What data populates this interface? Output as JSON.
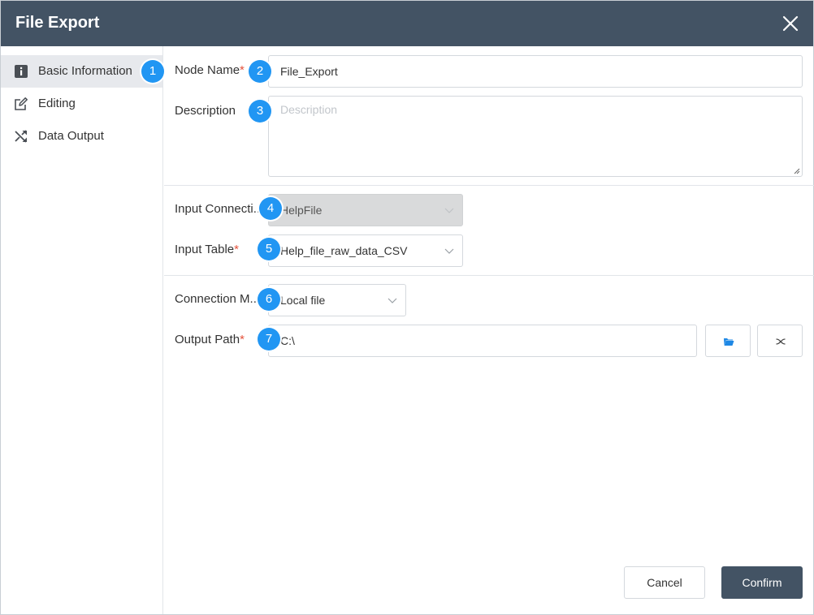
{
  "dialog": {
    "title": "File Export"
  },
  "sidebar": {
    "items": [
      {
        "label": "Basic Information",
        "icon": "info-icon",
        "active": true,
        "badge": "1"
      },
      {
        "label": "Editing",
        "icon": "edit-icon",
        "active": false
      },
      {
        "label": "Data Output",
        "icon": "shuffle-icon",
        "active": false
      }
    ]
  },
  "form": {
    "node_name": {
      "label": "Node Name",
      "required": "*",
      "value": "File_Export",
      "badge": "2"
    },
    "description": {
      "label": "Description",
      "placeholder": "Description",
      "badge": "3"
    },
    "input_connection": {
      "label": "Input Connecti...",
      "value": "HelpFile",
      "badge": "4",
      "disabled": true
    },
    "input_table": {
      "label": "Input Table",
      "required": "*",
      "value": "Help_file_raw_data_CSV",
      "badge": "5"
    },
    "connection_mode": {
      "label": "Connection M...",
      "value": "Local file",
      "badge": "6"
    },
    "output_path": {
      "label": "Output Path",
      "required": "*",
      "value": "C:\\",
      "badge": "7"
    }
  },
  "footer": {
    "cancel_label": "Cancel",
    "confirm_label": "Confirm"
  },
  "colors": {
    "header": "#435364",
    "badge": "#2196f3",
    "required": "#e5533c",
    "folder_icon": "#1e88e5"
  }
}
